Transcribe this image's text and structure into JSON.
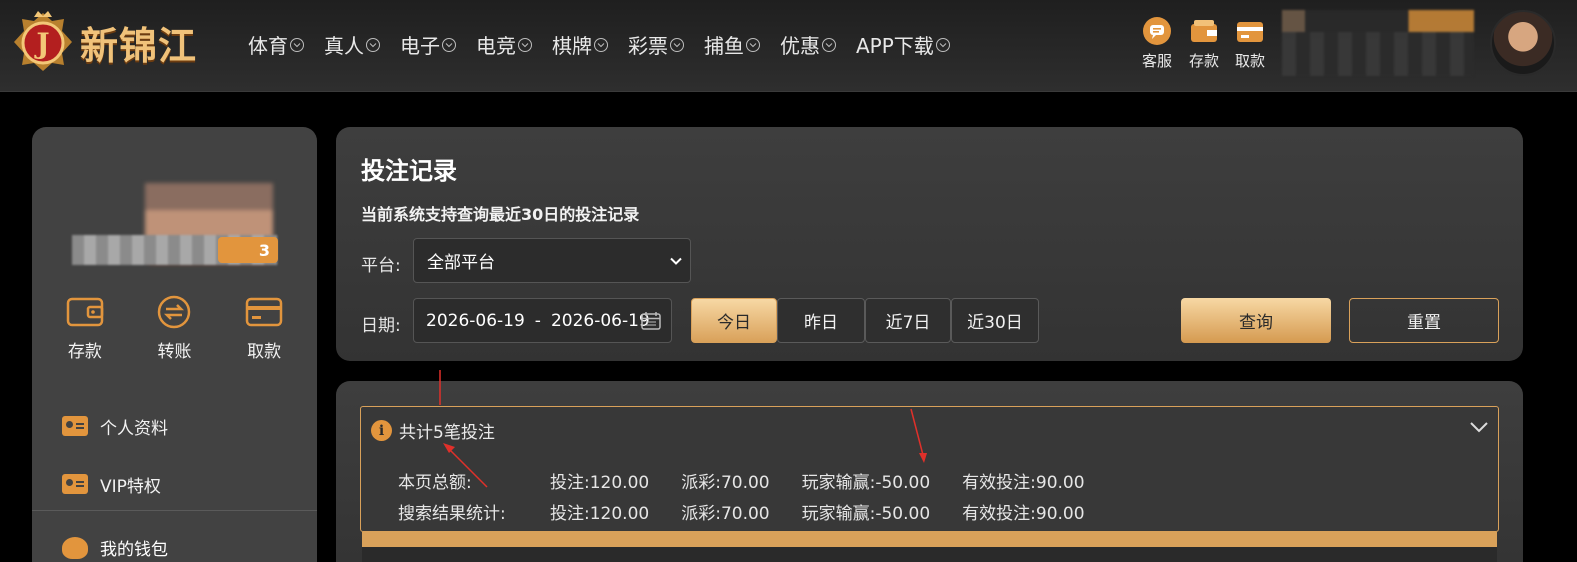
{
  "brand": {
    "logo_text": "新锦江",
    "badge_letter": "J"
  },
  "nav": [
    {
      "label": "体育"
    },
    {
      "label": "真人"
    },
    {
      "label": "电子"
    },
    {
      "label": "电竞"
    },
    {
      "label": "棋牌"
    },
    {
      "label": "彩票"
    },
    {
      "label": "捕鱼"
    },
    {
      "label": "优惠"
    },
    {
      "label": "APP下载"
    }
  ],
  "quick_actions": [
    {
      "label": "客服",
      "icon": "chat-icon"
    },
    {
      "label": "存款",
      "icon": "wallet-icon"
    },
    {
      "label": "取款",
      "icon": "withdraw-icon"
    }
  ],
  "sidebar": {
    "vip_level": "3",
    "actions": [
      {
        "label": "存款",
        "icon": "wallet-icon"
      },
      {
        "label": "转账",
        "icon": "transfer-icon"
      },
      {
        "label": "取款",
        "icon": "card-icon"
      }
    ],
    "menu": [
      {
        "label": "个人资料"
      },
      {
        "label": "VIP特权"
      }
    ],
    "wallet_label": "我的钱包"
  },
  "filter": {
    "title": "投注记录",
    "subtitle": "当前系统支持查询最近30日的投注记录",
    "platform_label": "平台:",
    "platform_value": "全部平台",
    "date_label": "日期:",
    "date_start": "2026-06-19",
    "date_sep": "-",
    "date_end": "2026-06-19",
    "ranges": [
      "今日",
      "昨日",
      "近7日",
      "近30日"
    ],
    "active_range": "今日",
    "query_label": "查询",
    "reset_label": "重置"
  },
  "summary": {
    "header": "共计5笔投注",
    "rows": [
      {
        "label": "本页总额:",
        "bet": "投注:120.00",
        "payout": "派彩:70.00",
        "winloss": "玩家输赢:-50.00",
        "valid": "有效投注:90.00"
      },
      {
        "label": "搜索结果统计:",
        "bet": "投注:120.00",
        "payout": "派彩:70.00",
        "winloss": "玩家输赢:-50.00",
        "valid": "有效投注:90.00"
      }
    ]
  },
  "colors": {
    "accent": "#d9a15a",
    "panel": "#424242",
    "annotation": "#e0302a"
  }
}
